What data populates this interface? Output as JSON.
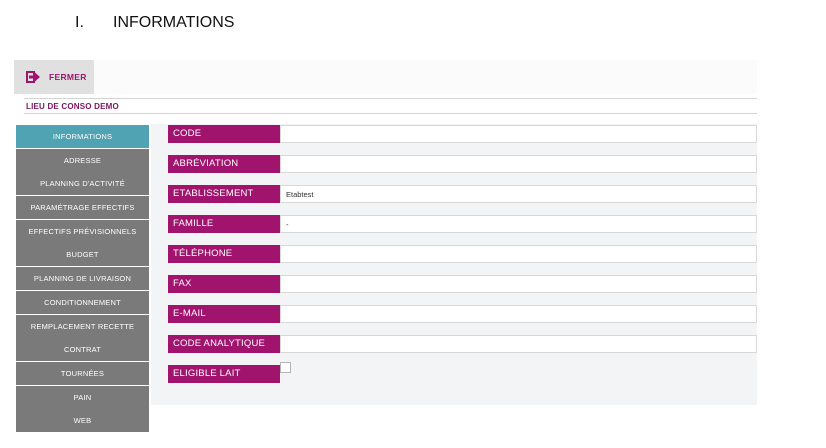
{
  "document": {
    "section_number": "I.",
    "section_title": "INFORMATIONS"
  },
  "toolbar": {
    "close_label": "FERMER",
    "close_icon": "sign-out-icon",
    "accent_color": "#a0146e"
  },
  "site": {
    "name": "LIEU DE CONSO DEMO"
  },
  "sidebar": {
    "active_color": "#4fa3b3",
    "items": [
      {
        "label": "INFORMATIONS",
        "active": true
      },
      {
        "label": "ADRESSE",
        "active": false
      },
      {
        "label": "PLANNING D'ACTIVITÉ",
        "active": false
      },
      {
        "label": "PARAMÉTRAGE EFFECTIFS",
        "active": false
      },
      {
        "label": "EFFECTIFS PRÉVISIONNELS",
        "active": false
      },
      {
        "label": "BUDGET",
        "active": false
      },
      {
        "label": "PLANNING DE LIVRAISON",
        "active": false
      },
      {
        "label": "CONDITIONNEMENT",
        "active": false
      },
      {
        "label": "REMPLACEMENT RECETTE",
        "active": false
      },
      {
        "label": "CONTRAT",
        "active": false
      },
      {
        "label": "TOURNÉES",
        "active": false
      },
      {
        "label": "PAIN",
        "active": false
      },
      {
        "label": "WEB",
        "active": false
      }
    ]
  },
  "form": {
    "fields": [
      {
        "label": "CODE",
        "value": ""
      },
      {
        "label": "ABRÉVIATION",
        "value": ""
      },
      {
        "label": "ETABLISSEMENT",
        "value": "Etabtest"
      },
      {
        "label": "FAMILLE",
        "value": "-"
      },
      {
        "label": "TÉLÉPHONE",
        "value": ""
      },
      {
        "label": "FAX",
        "value": ""
      },
      {
        "label": "E-MAIL",
        "value": ""
      },
      {
        "label": "CODE ANALYTIQUE",
        "value": ""
      }
    ],
    "checkbox": {
      "label": "ELIGIBLE LAIT",
      "checked": false
    }
  }
}
